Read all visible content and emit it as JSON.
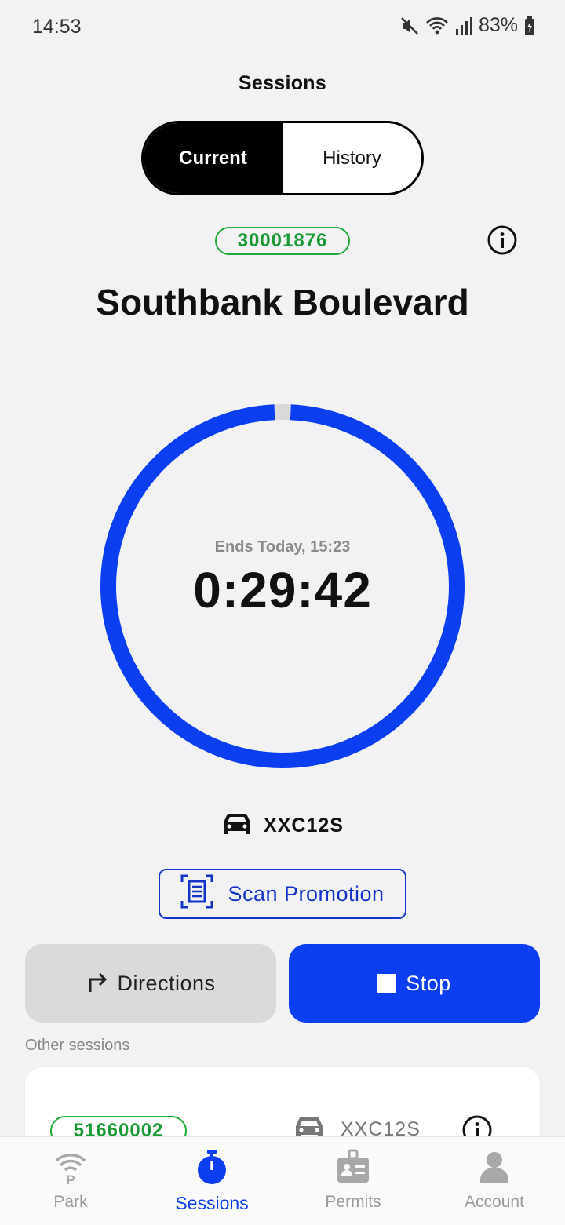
{
  "status_bar": {
    "time": "14:53",
    "battery": "83%",
    "icons": [
      "mute-icon",
      "wifi-icon",
      "signal-icon",
      "battery-charging-icon"
    ]
  },
  "header": {
    "title": "Sessions"
  },
  "tabs": [
    {
      "label": "Current",
      "active": true
    },
    {
      "label": "History",
      "active": false
    }
  ],
  "session": {
    "zone": "30001876",
    "location": "Southbank Boulevard",
    "ends_label": "Ends Today, 15:23",
    "countdown": "0:29:42",
    "remaining_fraction": 0.985,
    "vehicle_plate": "XXC12S"
  },
  "actions": {
    "scan_label": "Scan Promotion",
    "directions_label": "Directions",
    "stop_label": "Stop"
  },
  "other_sessions": {
    "label": "Other sessions",
    "items": [
      {
        "zone": "51660002",
        "plate": "XXC12S"
      }
    ]
  },
  "nav": [
    {
      "label": "Park",
      "icon": "park-icon",
      "active": false
    },
    {
      "label": "Sessions",
      "icon": "stopwatch-icon",
      "active": true
    },
    {
      "label": "Permits",
      "icon": "permit-icon",
      "active": false
    },
    {
      "label": "Account",
      "icon": "account-icon",
      "active": false
    }
  ],
  "colors": {
    "accent": "#0a3ef0",
    "zone_green": "#1a9a34",
    "background": "#f2f2f4"
  }
}
